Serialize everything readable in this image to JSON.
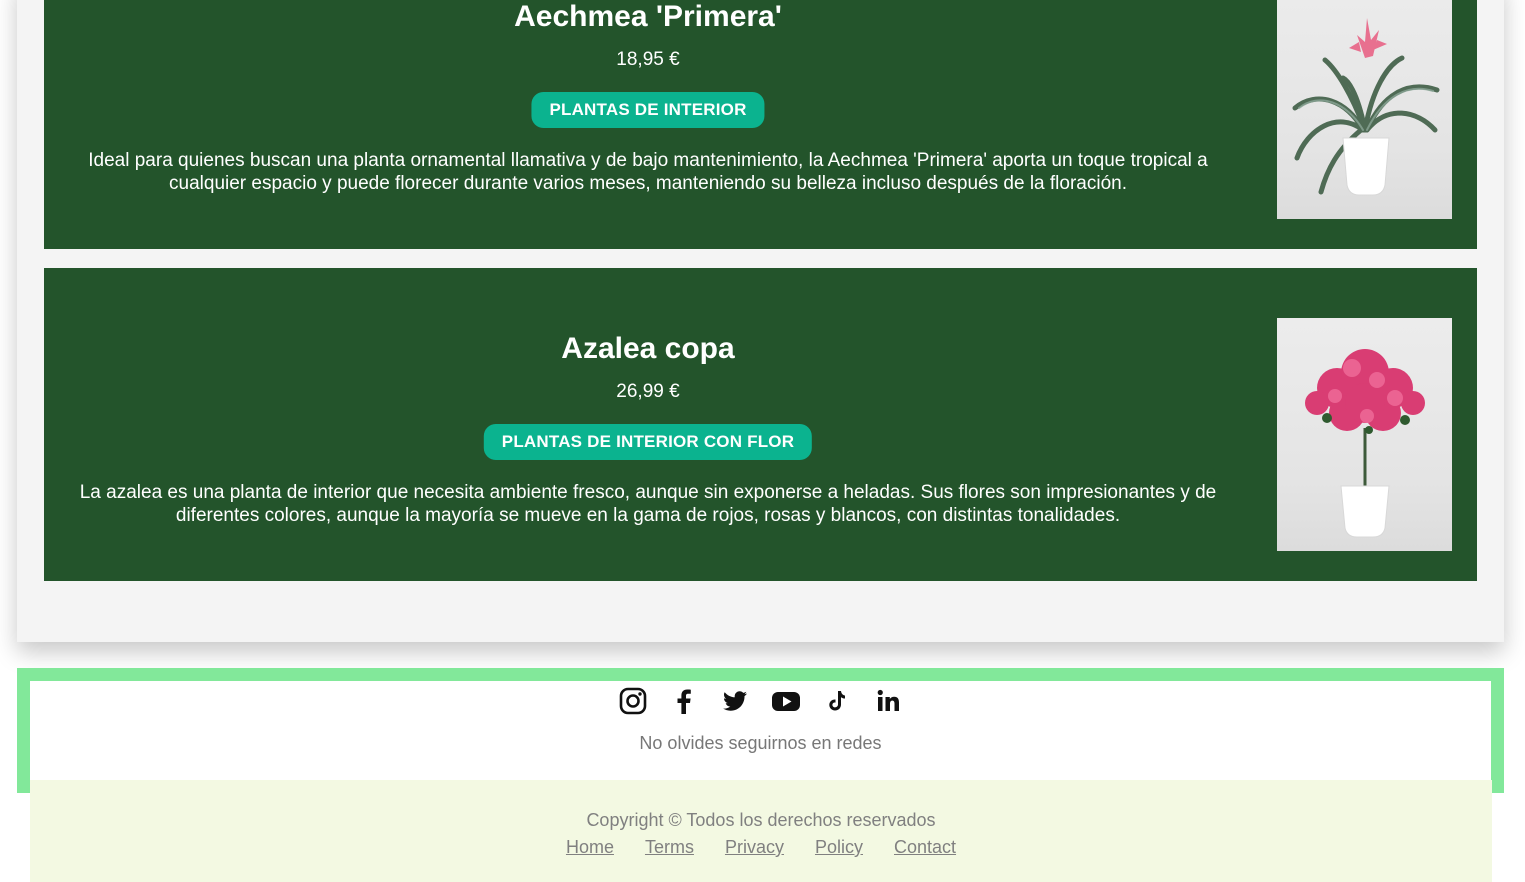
{
  "products": [
    {
      "name": "Aechmea 'Primera'",
      "price": "18,95 €",
      "category": "PLANTAS DE INTERIOR",
      "description": "Ideal para quienes buscan una planta ornamental llamativa y de bajo mantenimiento, la Aechmea 'Primera' aporta un toque tropical a cualquier espacio y puede florecer durante varios meses, manteniendo su belleza incluso después de la floración."
    },
    {
      "name": "Azalea copa",
      "price": "26,99 €",
      "category": "PLANTAS DE INTERIOR CON FLOR",
      "description": "La azalea es una planta de interior que necesita ambiente fresco, aunque sin exponerse a heladas. Sus flores son impresionantes y de diferentes colores, aunque la mayoría se mueve en la gama de rojos, rosas y blancos, con distintas tonalidades."
    }
  ],
  "footer": {
    "social_icons": [
      "instagram-icon",
      "facebook-icon",
      "twitter-icon",
      "youtube-icon",
      "tiktok-icon",
      "linkedin-icon"
    ],
    "follow_text": "No olvides seguirnos en redes",
    "copyright": "Copyright © Todos los derechos reservados",
    "links": [
      "Home",
      "Terms",
      "Privacy",
      "Policy",
      "Contact"
    ]
  },
  "colors": {
    "card_bg": "#23542b",
    "badge_bg": "#0bb38f",
    "footer_border": "#82e89a",
    "footer_bottom_bg": "#f3f9e2"
  }
}
